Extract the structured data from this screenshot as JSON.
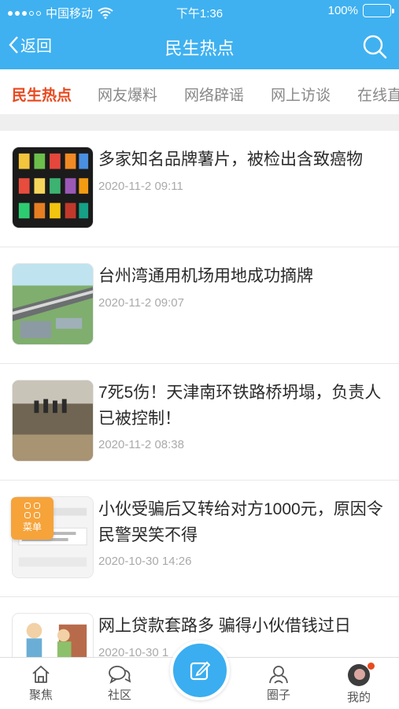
{
  "status_bar": {
    "carrier": "中国移动",
    "time": "下午1:36",
    "battery": "100%"
  },
  "nav": {
    "back_label": "返回",
    "title": "民生热点"
  },
  "tabs": [
    {
      "label": "民生热点",
      "active": true
    },
    {
      "label": "网友爆料",
      "active": false
    },
    {
      "label": "网络辟谣",
      "active": false
    },
    {
      "label": "网上访谈",
      "active": false
    },
    {
      "label": "在线直",
      "active": false
    }
  ],
  "news": [
    {
      "title": "多家知名品牌薯片，被检出含致癌物",
      "date": "2020-11-2 09:11"
    },
    {
      "title": "台州湾通用机场用地成功摘牌",
      "date": "2020-11-2 09:07"
    },
    {
      "title": "7死5伤！天津南环铁路桥坍塌，负责人已被控制！",
      "date": "2020-11-2 08:38"
    },
    {
      "title": "小伙受骗后又转给对方1000元，原因令民警哭笑不得",
      "date": "2020-10-30 14:26"
    },
    {
      "title": "网上贷款套路多 骗得小伙借钱过日",
      "date": "2020-10-30 1"
    }
  ],
  "float_menu": {
    "label": "菜单"
  },
  "tabbar": {
    "focus": "聚焦",
    "community": "社区",
    "circle": "圈子",
    "mine": "我的"
  },
  "colors": {
    "primary": "#3fb1f0",
    "accent": "#e84a1f",
    "menu": "#f6a33a"
  }
}
